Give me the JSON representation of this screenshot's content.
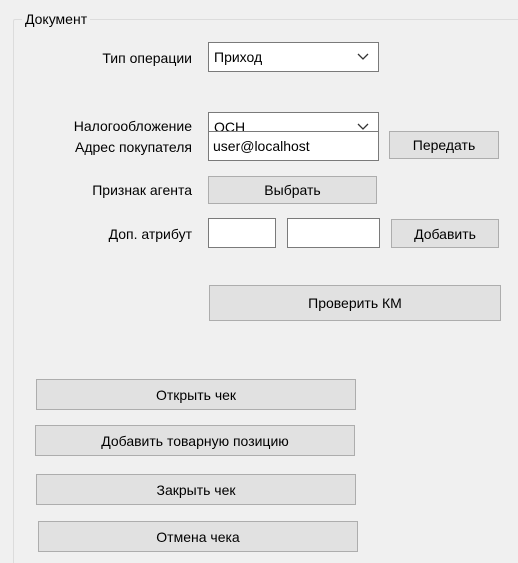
{
  "group": {
    "title": "Документ"
  },
  "operation_type": {
    "label": "Тип операции",
    "value": "Приход",
    "icon": "chevron-down-icon"
  },
  "taxation": {
    "label": "Налогообложение",
    "value": "ОСН",
    "icon": "chevron-down-icon"
  },
  "buyer_address": {
    "label": "Адрес покупателя",
    "value": "user@localhost",
    "send_label": "Передать"
  },
  "agent_sign": {
    "label": "Признак агента",
    "choose_label": "Выбрать"
  },
  "extra_attr": {
    "label": "Доп. атрибут",
    "value1": "",
    "value2": "",
    "add_label": "Добавить"
  },
  "check_km": {
    "label": "Проверить КМ"
  },
  "actions": {
    "open_receipt": "Открыть чек",
    "add_item": "Добавить товарную позицию",
    "close_receipt": "Закрыть чек",
    "cancel_receipt": "Отмена чека"
  }
}
